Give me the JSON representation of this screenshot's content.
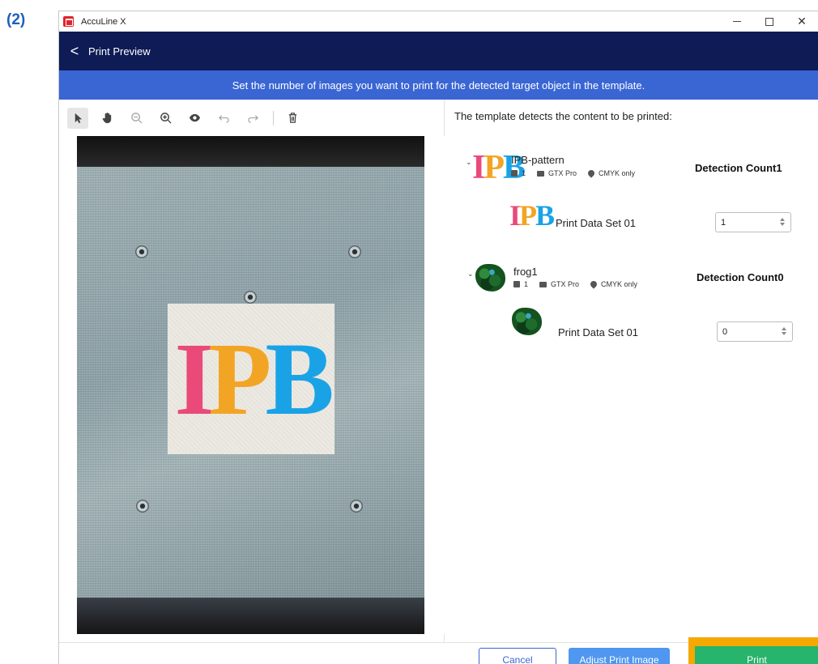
{
  "figure_label": "(2)",
  "window": {
    "app_title": "AccuLine X",
    "controls": {
      "minimize": "—",
      "maximize": "□",
      "close": "✕"
    }
  },
  "nav": {
    "back_icon": "<",
    "title": "Print Preview"
  },
  "banner": {
    "text": "Set the number of images you want to print for the detected target object in the template."
  },
  "toolbar": {
    "tools": [
      "select-arrow-icon",
      "hand-icon",
      "zoom-out-icon",
      "zoom-in-icon",
      "eye-icon",
      "undo-icon",
      "redo-icon",
      "trash-icon"
    ]
  },
  "preview": {
    "logo_letters": [
      "I",
      "P",
      "B"
    ]
  },
  "right": {
    "heading": "The template detects the content to be printed:",
    "groups": [
      {
        "name": "IPB-pattern",
        "meta": {
          "image_count": "1",
          "printer": "GTX Pro",
          "color_mode": "CMYK only"
        },
        "detection_label": "Detection Count",
        "detection_value": "1",
        "rows": [
          {
            "label": "Print Data Set 01",
            "value": "1"
          }
        ]
      },
      {
        "name": "frog1",
        "meta": {
          "image_count": "1",
          "printer": "GTX Pro",
          "color_mode": "CMYK only"
        },
        "detection_label": "Detection Count",
        "detection_value": "0",
        "rows": [
          {
            "label": "Print Data Set 01",
            "value": "0"
          }
        ]
      }
    ]
  },
  "footer": {
    "cancel": "Cancel",
    "adjust": "Adjust Print Image",
    "print": "Print"
  },
  "colors": {
    "navbar": "#0e1b54",
    "banner": "#3a66d4",
    "print_button": "#27b46c",
    "print_highlight": "#f4a800",
    "adjust_button": "#4f97f0"
  }
}
